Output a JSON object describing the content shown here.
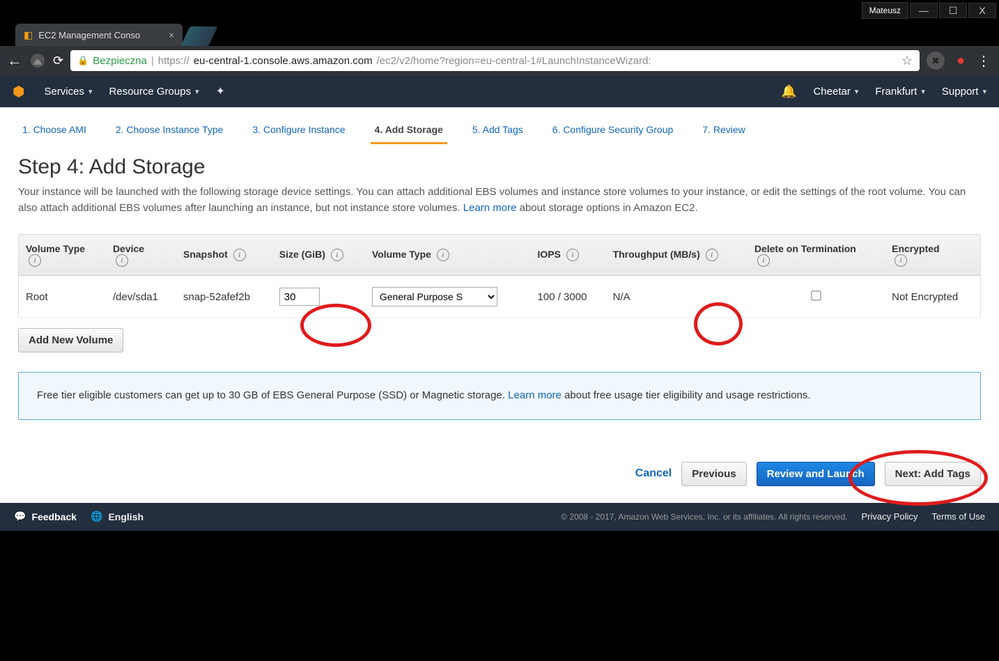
{
  "window": {
    "user": "Mateusz",
    "buttons": {
      "min": "—",
      "max": "☐",
      "close": "X"
    }
  },
  "browser": {
    "tab_title": "EC2 Management Conso",
    "secure_label": "Bezpieczna",
    "url_prefix": "https://",
    "url_host": "eu-central-1.console.aws.amazon.com",
    "url_path": "/ec2/v2/home?region=eu-central-1#LaunchInstanceWizard:"
  },
  "aws_nav": {
    "services": "Services",
    "resource_groups": "Resource Groups",
    "account": "Cheetar",
    "region": "Frankfurt",
    "support": "Support"
  },
  "wizard": {
    "tabs": [
      "1. Choose AMI",
      "2. Choose Instance Type",
      "3. Configure Instance",
      "4. Add Storage",
      "5. Add Tags",
      "6. Configure Security Group",
      "7. Review"
    ],
    "active_index": 3
  },
  "step": {
    "title": "Step 4: Add Storage",
    "desc_before": "Your instance will be launched with the following storage device settings. You can attach additional EBS volumes and instance store volumes to your instance, or edit the settings of the root volume. You can also attach additional EBS volumes after launching an instance, but not instance store volumes. ",
    "learn_more": "Learn more",
    "desc_after": " about storage options in Amazon EC2."
  },
  "table": {
    "headers": {
      "volume_type": "Volume Type",
      "device": "Device",
      "snapshot": "Snapshot",
      "size": "Size (GiB)",
      "volume_type2": "Volume Type",
      "iops": "IOPS",
      "throughput": "Throughput (MB/s)",
      "delete_on_term": "Delete on Termination",
      "encrypted": "Encrypted"
    },
    "row": {
      "vtype": "Root",
      "device": "/dev/sda1",
      "snapshot": "snap-52afef2b",
      "size": "30",
      "voltype_sel": "General Purpose S",
      "iops": "100 / 3000",
      "throughput": "N/A",
      "encrypted": "Not Encrypted"
    },
    "add_new_volume": "Add New Volume"
  },
  "banner": {
    "text_before": "Free tier eligible customers can get up to 30 GB of EBS General Purpose (SSD) or Magnetic storage. ",
    "learn_more": "Learn more",
    "text_after": " about free usage tier eligibility and usage restrictions."
  },
  "actions": {
    "cancel": "Cancel",
    "previous": "Previous",
    "review": "Review and Launch",
    "next": "Next: Add Tags"
  },
  "footer": {
    "feedback": "Feedback",
    "language": "English",
    "copyright": "© 2008 - 2017, Amazon Web Services, Inc. or its affiliates. All rights reserved.",
    "privacy": "Privacy Policy",
    "terms": "Terms of Use"
  }
}
